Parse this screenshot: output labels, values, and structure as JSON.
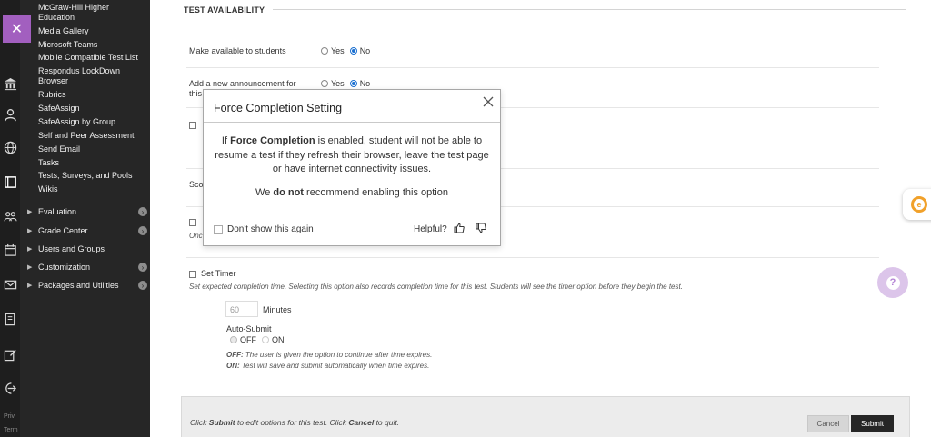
{
  "course_menu": {
    "tools": [
      "McGraw-Hill Higher Education",
      "Media Gallery",
      "Microsoft Teams",
      "Mobile Compatible Test List",
      "Respondus LockDown Browser",
      "Rubrics",
      "SafeAssign",
      "SafeAssign by Group",
      "Self and Peer Assessment",
      "Send Email",
      "Tasks",
      "Tests, Surveys, and Pools",
      "Wikis"
    ],
    "groups": [
      "Evaluation",
      "Grade Center",
      "Users and Groups",
      "Customization",
      "Packages and Utilities"
    ]
  },
  "rail": {
    "privacy_text": "Priv",
    "terms_text": "Term"
  },
  "section": {
    "title": "TEST AVAILABILITY"
  },
  "form": {
    "make_available_label": "Make available to students",
    "yes": "Yes",
    "no": "No",
    "announcement_label_line1": "Add a new announcement for",
    "announcement_label_line2": "this",
    "score_partial": "Sco",
    "once_partial": "Onc",
    "set_timer_label": "Set Timer",
    "set_timer_help": "Set expected completion time. Selecting this option also records completion time for this test. Students will see the timer option before they begin the test.",
    "timer_minutes_value": "60",
    "minutes_label": "Minutes",
    "auto_submit_label": "Auto-Submit",
    "off": "OFF",
    "on": "ON",
    "off_help_key": "OFF:",
    "off_help": " The user is given the option to continue after time expires.",
    "on_help_key": "ON:",
    "on_help": " Test will save and submit automatically when time expires."
  },
  "footer": {
    "text_1": "Click ",
    "submit_word": "Submit",
    "text_2": " to edit options for this test. Click ",
    "cancel_word": "Cancel",
    "text_3": " to quit.",
    "cancel_button": "Cancel",
    "submit_button": "Submit"
  },
  "modal": {
    "title": "Force Completion Setting",
    "body_prefix": "If ",
    "body_bold": "Force Completion",
    "body_rest": " is enabled, student will not be able to resume a test if they refresh their browser, leave the test page or have internet connectivity issues.",
    "rec_prefix": "We ",
    "rec_bold": "do not",
    "rec_rest": " recommend enabling this option",
    "dont_show": "Don't show this again",
    "helpful": "Helpful?"
  },
  "colors": {
    "accent": "#a25fbf",
    "radio_selected": "#1a6fd1",
    "sidebar": "#262626"
  }
}
